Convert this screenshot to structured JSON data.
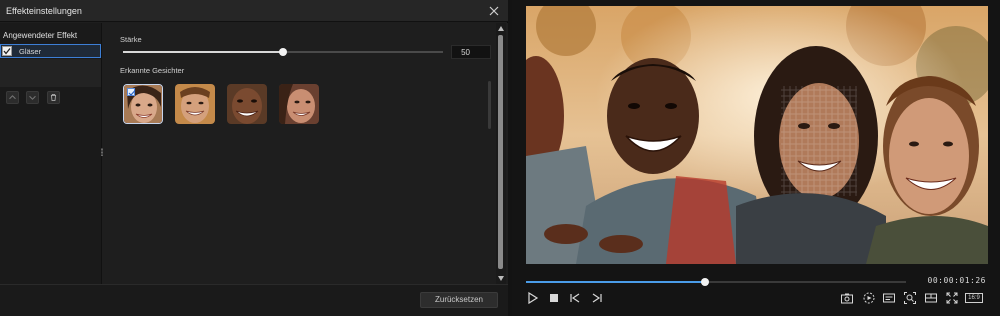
{
  "dialog": {
    "title": "Effekteinstellungen",
    "left_pane": {
      "title": "Angewendeter Effekt",
      "effects": [
        {
          "label": "Gläser",
          "checked": true
        }
      ]
    },
    "strength": {
      "label": "Stärke",
      "value": "50",
      "level_fraction": 0.5
    },
    "faces": {
      "label": "Erkannte Gesichter",
      "count": 4,
      "selected_index": 0
    },
    "reset_label": "Zurücksetzen"
  },
  "player": {
    "timecode": "00:00:01:26",
    "progress_fraction": 0.47,
    "aspect_label": "16:9"
  },
  "colors": {
    "accent": "#3d7fd6",
    "timeline_accent": "#4a9ce8",
    "panel_bg": "#1e1e1e"
  }
}
